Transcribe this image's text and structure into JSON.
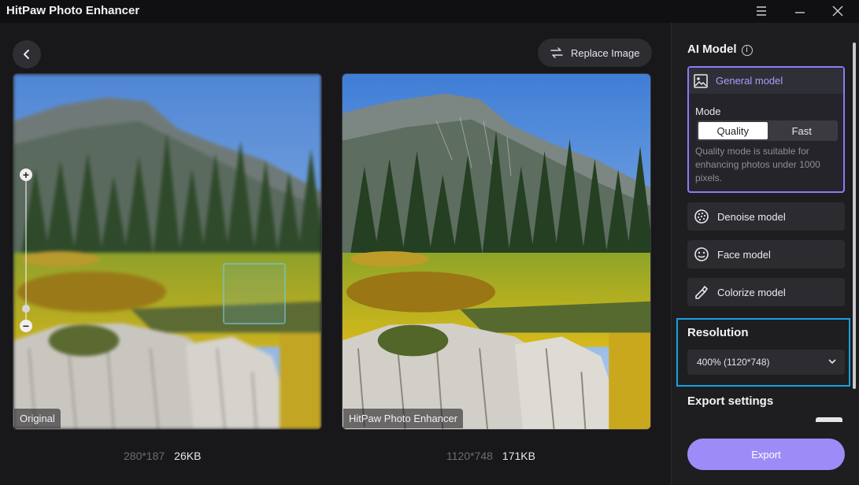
{
  "app": {
    "title": "HitPaw Photo Enhancer"
  },
  "toolbar": {
    "replace_label": "Replace Image"
  },
  "panels": {
    "original_label": "Original",
    "enhanced_label": "HitPaw Photo Enhancer",
    "zoom_level": 0.12
  },
  "original_info": {
    "dimensions": "280*187",
    "size": "26KB"
  },
  "enhanced_info": {
    "dimensions": "1120*748",
    "size": "171KB"
  },
  "sidebar": {
    "ai_model_title": "AI Model",
    "general_model": "General model",
    "mode_label": "Mode",
    "mode_options": [
      "Quality",
      "Fast"
    ],
    "mode_selected": "Quality",
    "mode_description": "Quality mode is suitable for enhancing photos under 1000 pixels.",
    "models": [
      {
        "label": "Denoise model",
        "icon": "denoise-icon"
      },
      {
        "label": "Face model",
        "icon": "face-icon"
      },
      {
        "label": "Colorize model",
        "icon": "colorize-icon"
      }
    ],
    "resolution_title": "Resolution",
    "resolution_value": "400% (1120*748)",
    "export_settings_title": "Export settings",
    "export_label": "Export"
  },
  "colors": {
    "accent": "#9d8cf7",
    "highlight_border": "#1a9fe0"
  }
}
